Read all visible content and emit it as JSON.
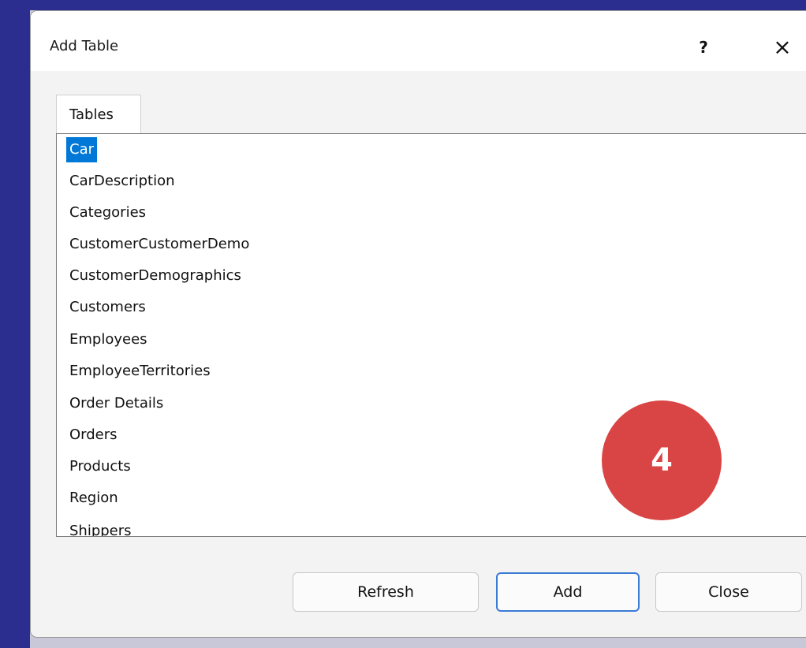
{
  "dialog": {
    "title": "Add Table",
    "help_label": "?",
    "close_label": "×"
  },
  "tab": {
    "label": "Tables"
  },
  "list": {
    "selected_index": 0,
    "items": [
      "Car",
      "CarDescription",
      "Categories",
      "CustomerCustomerDemo",
      "CustomerDemographics",
      "Customers",
      "Employees",
      "EmployeeTerritories",
      "Order Details",
      "Orders",
      "Products",
      "Region",
      "Shippers"
    ]
  },
  "badge": {
    "number": "4",
    "color": "#d94545"
  },
  "buttons": {
    "refresh": "Refresh",
    "add": "Add",
    "close": "Close"
  },
  "colors": {
    "selection": "#0078d7",
    "frame": "#2b2e8e",
    "default_button_border": "#3a7bd5"
  }
}
